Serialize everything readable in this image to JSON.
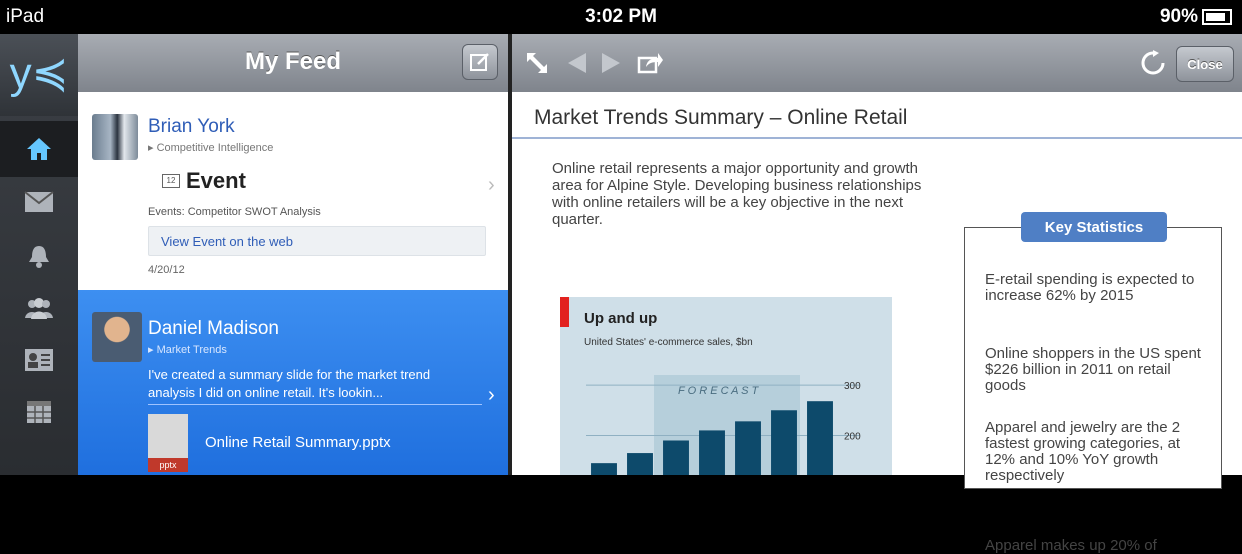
{
  "status_bar": {
    "device": "iPad",
    "time": "3:02 PM",
    "battery": "90%"
  },
  "sidebar": {
    "logo": "y≼"
  },
  "feed": {
    "title": "My Feed",
    "posts": [
      {
        "author": "Brian York",
        "group": "Competitive Intelligence",
        "type_label": "Event",
        "description": "Events: Competitor SWOT Analysis",
        "link_label": "View Event on the web",
        "date": "4/20/12"
      },
      {
        "author": "Daniel Madison",
        "group": "Market Trends",
        "message": "I've created a summary slide for the market trend analysis I did on online retail. It's lookin...",
        "attachment_name": "Online Retail Summary.pptx",
        "attachment_ext": "pptx"
      }
    ]
  },
  "document": {
    "close_label": "Close",
    "title": "Market Trends Summary – Online Retail",
    "intro": "Online retail represents a major opportunity and growth area for Alpine Style. Developing business relationships with online retailers will be a key objective in the next quarter.",
    "chart_title": "Up and up",
    "chart_subtitle": "United States' e-commerce sales, $bn",
    "forecast_label": "F O R E C A S T",
    "stats_title": "Key Statistics",
    "stats": [
      "E-retail spending is expected to increase 62% by 2015",
      "Online shoppers in the US spent $226 billion in 2011 on retail goods",
      "Apparel and jewelry are the 2 fastest growing categories, at 12% and 10% YoY growth respectively",
      "Apparel makes up 20% of"
    ]
  },
  "chart_data": {
    "type": "bar",
    "title": "Up and up",
    "subtitle": "United States' e-commerce sales, $bn",
    "values": [
      145,
      165,
      190,
      210,
      228,
      250,
      268
    ],
    "ylim": [
      50,
      320
    ],
    "yticks": [
      100,
      200,
      300
    ],
    "forecast_start_index": 3
  },
  "colors": {
    "accent_blue": "#2a74e0",
    "link_blue": "#2f5db7",
    "bar_color": "#0d4a6b",
    "forecast_bg": "#b6cfdb"
  }
}
